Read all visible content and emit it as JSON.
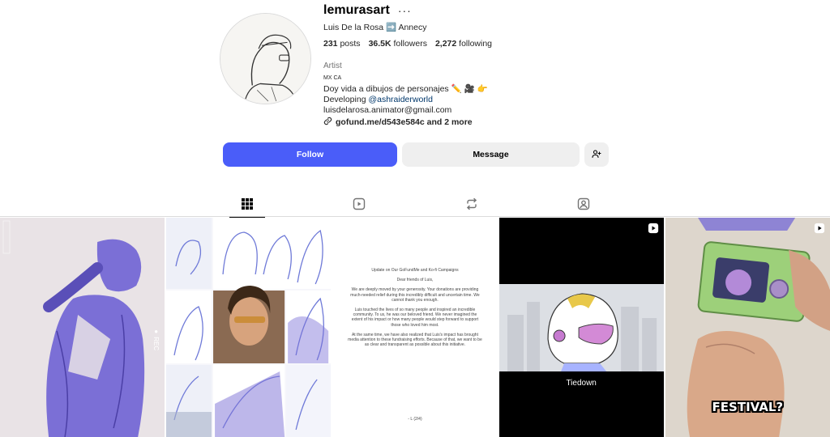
{
  "profile": {
    "username": "lemurasart",
    "more_icon": "more-horizontal-icon",
    "full_name": "Luis De la Rosa ➡️ Annecy",
    "stats": {
      "posts_count": "231",
      "posts_label": "posts",
      "followers_count": "36.5K",
      "followers_label": "followers",
      "following_count": "2,272",
      "following_label": "following"
    },
    "category": "Artist",
    "bio": {
      "location_line": "MX CA",
      "line1": "Doy vida a dibujos de personajes ✏️ 🎥 👉",
      "developing_prefix": "Developing ",
      "developing_mention": "@ashraiderworld",
      "email": "luisdelarosa.animator@gmail.com"
    },
    "link_text": "gofund.me/d543e584c and 2 more",
    "link_icon": "link-icon"
  },
  "actions": {
    "follow_label": "Follow",
    "message_label": "Message",
    "suggest_icon": "person-add-icon"
  },
  "tabs": [
    {
      "name": "posts",
      "icon": "grid-icon",
      "active": true
    },
    {
      "name": "reels",
      "icon": "reels-icon",
      "active": false
    },
    {
      "name": "reposts",
      "icon": "repost-icon",
      "active": false
    },
    {
      "name": "tagged",
      "icon": "tagged-icon",
      "active": false
    }
  ],
  "posts": {
    "post3_letter": {
      "title": "Update on Our GoFundMe and Ko-fi Campaigns",
      "salutation": "Dear friends of Luis,",
      "p1": "We are deeply moved by your generosity. Your donations are providing much-needed relief during this incredibly difficult and uncertain time. We cannot thank you enough.",
      "p2": "Luis touched the lives of so many people and inspired an incredible community. To us, he was our beloved friend. We never imagined the extent of his impact or how many people would step forward to support those who loved him most.",
      "p3": "At the same time, we have also realized that Luis's impact has brought media attention to these fundraising efforts. Because of that, we want to be as clear and transparent as possible about this initiative.",
      "signature": "- L (2/4)"
    },
    "post4_caption": "Tiedown",
    "post5_caption": "FESTIVAL?",
    "post1_rec": "● REC"
  },
  "colors": {
    "follow_button": "#4a5df9",
    "secondary_button": "#efefef",
    "mention_link": "#00376b",
    "art_purple": "#7b6fd6"
  }
}
